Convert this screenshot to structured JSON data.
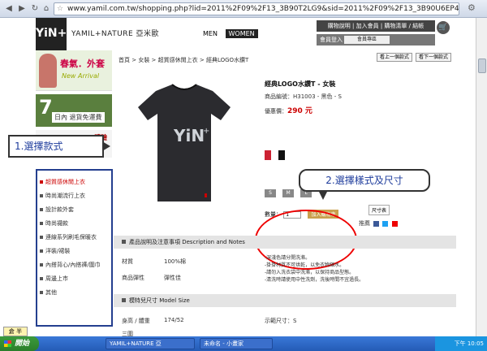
{
  "browser": {
    "url": "www.yamil.com.tw/shopping.php?lid=2011%2F09%2F13_3B90T2LG9&sid=2011%2F09%2F13_3B90U6EP4&pid=2012%2F01%2F10_3EMI"
  },
  "header": {
    "logo": "YiN+",
    "brand": "YAMIL+NATURE 亞米歐",
    "gender_men": "MEN",
    "gender_women": "WOMEN",
    "top_links": "購物說明 | 加入會員 | 購物清單 / 結帳",
    "member_links": "會員登入",
    "member_tag": "會員專區"
  },
  "sidebar": {
    "banner1_title": "春氣．外套",
    "banner1_sub": "New Arrival",
    "banner2_num": "7",
    "banner2_text": "日內 退貨免運費",
    "banner3_text": "體驗",
    "callout": "1.選擇款式",
    "categories": [
      {
        "label": "超質感休閒上衣"
      },
      {
        "label": "時尚潮流行上衣"
      },
      {
        "label": "設計款外套"
      },
      {
        "label": "時尚襪款"
      },
      {
        "label": "連線系列刷毛保暖衣"
      },
      {
        "label": "洋裝/裙裝"
      },
      {
        "label": "內搭背心/內搭褲/圍巾"
      },
      {
        "label": "周邊上市"
      },
      {
        "label": "其他"
      }
    ]
  },
  "main": {
    "breadcrumb": "首頁 > 女裝 > 超質感休閒上衣 > 經典LOGO水鑽T",
    "prev": "看上一個款式",
    "next": "看下一個款式",
    "product_title": "經典LOGO水鑽T - 女裝",
    "product_code": "商品編號：H31003 - 黑色 - S",
    "price_label": "優惠價：",
    "price_value": "290 元",
    "sizes": [
      "S",
      "M",
      "L"
    ],
    "qty_label": "數量：",
    "qty_value": "1",
    "add_cart": "加入購物車",
    "size_chart": "尺寸表",
    "share": "推薦",
    "callout2": "2.選擇樣式及尺寸",
    "notes_header": "產品說明及注意事項 Description and Notes",
    "material_label": "材質",
    "material_value": "100%棉",
    "elastic_label": "商品彈性",
    "elastic_value": "彈性佳",
    "care_notes": [
      "-深淺色請分開洗滌。",
      "-掛掛材質不可烘乾，以免衣物縮水。",
      "-請勿入洗衣袋中洗滌，以保持商品型態。",
      "-清洗時請使用中性洗劑，洗後時間不宜過長。"
    ],
    "model_header": "模特兒尺寸 Model Size",
    "model_height_label": "身高 / 體重",
    "model_height_value": "174/52",
    "model_size_label": "示範尺寸：S",
    "chest_label": "三圍"
  },
  "taskbar": {
    "start": "開始",
    "item1": "YAMIL+NATURE 亞",
    "item2": "未命名 - 小畫家",
    "clock": "下午 10:05"
  },
  "ime": "倉 半",
  "colors": {
    "accent_red": "#dd0000",
    "callout_blue": "#1e3c9c",
    "sidebar_border": "#243f8f"
  }
}
